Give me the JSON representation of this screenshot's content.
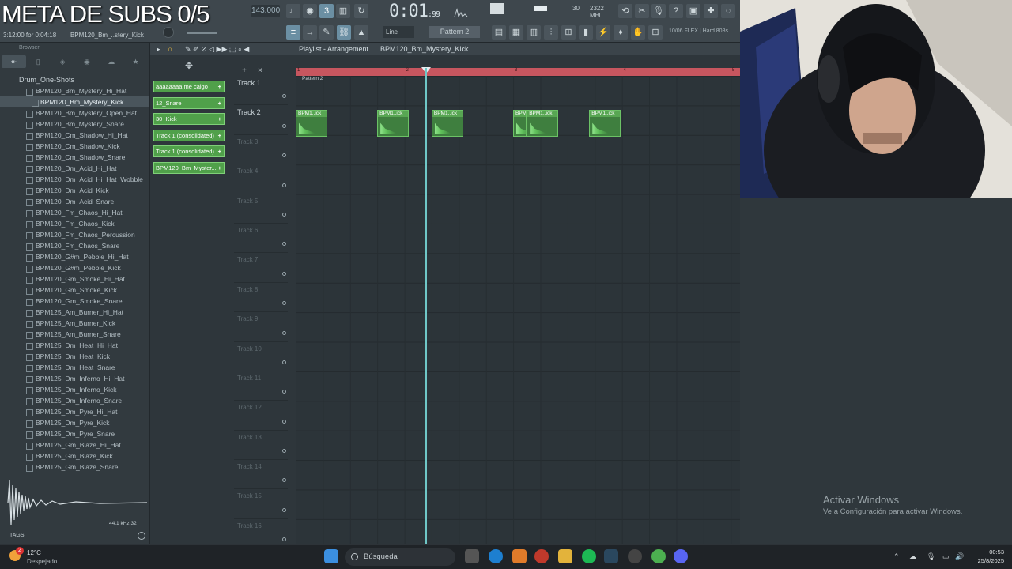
{
  "overlay": {
    "title": "META DE SUBS 0/5"
  },
  "toolbar": {
    "tempo": "143.000",
    "time_main": "0:01",
    "time_sub": "99",
    "hint": "3:12:00 for 0:04:18",
    "hint_file": "BPM120_Bm_..stery_Kick",
    "cpu_value": "30",
    "ram_value": "2322 MB",
    "ram_sub": "1",
    "snap": "Line",
    "pattern": "Pattern 2",
    "flex_info": "10/06 FLEX | Hard 808s",
    "accent_color": "#6b8fa3"
  },
  "browser": {
    "header": "Browser",
    "tabs": [
      "all",
      "files",
      "plugins",
      "packs",
      "history",
      "starred"
    ],
    "folder": "Drum_One-Shots",
    "files": [
      "BPM120_Bm_Mystery_Hi_Hat",
      "BPM120_Bm_Mystery_Kick",
      "BPM120_Bm_Mystery_Open_Hat",
      "BPM120_Bm_Mystery_Snare",
      "BPM120_Cm_Shadow_Hi_Hat",
      "BPM120_Cm_Shadow_Kick",
      "BPM120_Cm_Shadow_Snare",
      "BPM120_Dm_Acid_Hi_Hat",
      "BPM120_Dm_Acid_Hi_Hat_Wobble",
      "BPM120_Dm_Acid_Kick",
      "BPM120_Dm_Acid_Snare",
      "BPM120_Fm_Chaos_Hi_Hat",
      "BPM120_Fm_Chaos_Kick",
      "BPM120_Fm_Chaos_Percussion",
      "BPM120_Fm_Chaos_Snare",
      "BPM120_G#m_Pebble_Hi_Hat",
      "BPM120_G#m_Pebble_Kick",
      "BPM120_Gm_Smoke_Hi_Hat",
      "BPM120_Gm_Smoke_Kick",
      "BPM120_Gm_Smoke_Snare",
      "BPM125_Am_Burner_Hi_Hat",
      "BPM125_Am_Burner_Kick",
      "BPM125_Am_Burner_Snare",
      "BPM125_Dm_Heat_Hi_Hat",
      "BPM125_Dm_Heat_Kick",
      "BPM125_Dm_Heat_Snare",
      "BPM125_Dm_Inferno_Hi_Hat",
      "BPM125_Dm_Inferno_Kick",
      "BPM125_Dm_Inferno_Snare",
      "BPM125_Dm_Pyre_Hi_Hat",
      "BPM125_Dm_Pyre_Kick",
      "BPM125_Dm_Pyre_Snare",
      "BPM125_Gm_Blaze_Hi_Hat",
      "BPM125_Gm_Blaze_Kick",
      "BPM125_Gm_Blaze_Snare"
    ],
    "selected_index": 1,
    "sample_info": "44.1 kHz 32",
    "tags_label": "TAGS"
  },
  "playlist": {
    "title": "Playlist - Arrangement",
    "breadcrumb": "BPM120_Bm_Mystery_Kick",
    "pattern_strip": "Pattern 2",
    "picker": [
      "aaaaaaaa me caigo",
      "12_Snare",
      "30_Kick",
      "Track 1 (consolidated)",
      "Track 1 (consolidated)",
      "BPM120_Bm_Myster..."
    ],
    "tracks": [
      "Track 1",
      "Track 2",
      "Track 3",
      "Track 4",
      "Track 5",
      "Track 6",
      "Track 7",
      "Track 8",
      "Track 9",
      "Track 10",
      "Track 11",
      "Track 12",
      "Track 13",
      "Track 14",
      "Track 15",
      "Track 16"
    ],
    "bars": [
      "1",
      "2",
      "3",
      "4",
      "5"
    ],
    "clips": [
      {
        "label": "BPM1..ick",
        "start_bar": 1.0
      },
      {
        "label": "BPM1..ick",
        "start_bar": 1.75
      },
      {
        "label": "BPM1..ick",
        "start_bar": 2.25
      },
      {
        "label": "BPM1..ick",
        "start_bar": 3.0
      },
      {
        "label": "BPM1..ick",
        "start_bar": 3.125
      },
      {
        "label": "BPM1..ick",
        "start_bar": 3.7
      }
    ],
    "playhead_bar": 2.19,
    "clip_color": "#58a653"
  },
  "desktop": {
    "activate_title": "Activar Windows",
    "activate_sub": "Ve a Configuración para activar Windows."
  },
  "taskbar": {
    "weather_temp": "12°C",
    "weather_cond": "Despejado",
    "badge": "2",
    "search_placeholder": "Búsqueda",
    "time": "00:53",
    "date": "25/8/2025"
  }
}
